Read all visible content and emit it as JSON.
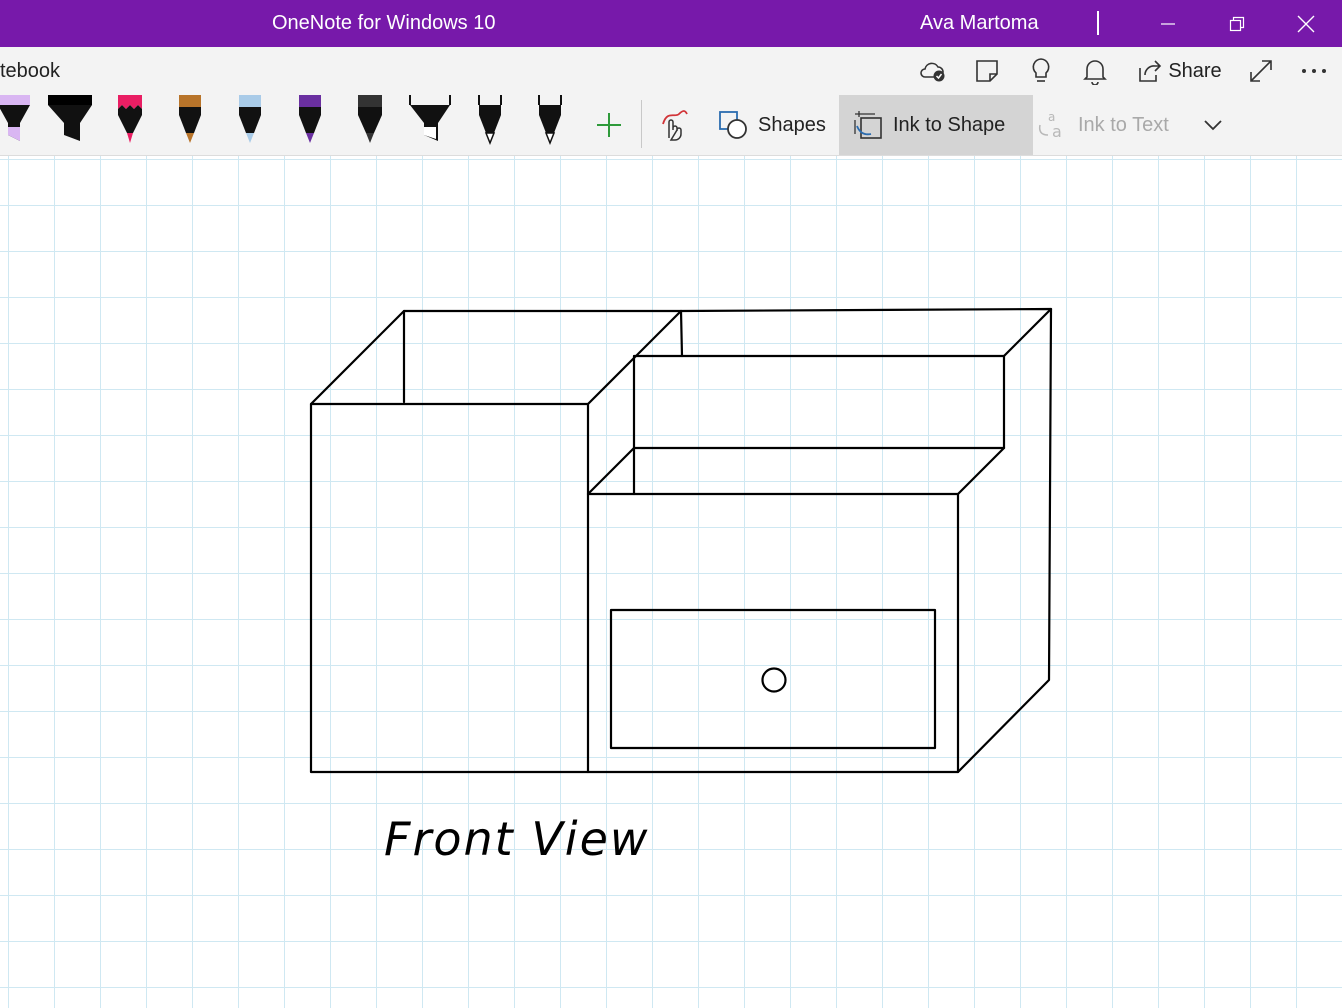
{
  "window": {
    "title": "OneNote for Windows 10",
    "user": "Ava Martoma",
    "accent": "#7719aa"
  },
  "header": {
    "notebook_fragment": "tebook",
    "share_label": "Share",
    "icons": [
      "sync-status-icon",
      "notebook-pages-icon",
      "lightbulb-icon",
      "bell-icon",
      "share-icon",
      "expand-icon",
      "more-icon"
    ]
  },
  "toolbar": {
    "pens": [
      {
        "name": "lavender-highlighter",
        "color": "#d9b6f2"
      },
      {
        "name": "black-highlighter",
        "color": "#000000"
      },
      {
        "name": "pink-galaxy-pen",
        "color": "#e91e63"
      },
      {
        "name": "bronze-pen",
        "color": "#b8742a"
      },
      {
        "name": "light-blue-pen",
        "color": "#a9cbe8"
      },
      {
        "name": "purple-pen",
        "color": "#6a2fa0"
      },
      {
        "name": "dark-gray-pen",
        "color": "#333333"
      },
      {
        "name": "black-highlighter-2",
        "color": "#000000"
      },
      {
        "name": "black-pen",
        "color": "#000000"
      },
      {
        "name": "black-pen-2",
        "color": "#000000"
      }
    ],
    "shapes_label": "Shapes",
    "ink_to_shape_label": "Ink to Shape",
    "ink_to_text_label": "Ink to Text"
  },
  "page": {
    "handwritten_caption": "Front View"
  }
}
